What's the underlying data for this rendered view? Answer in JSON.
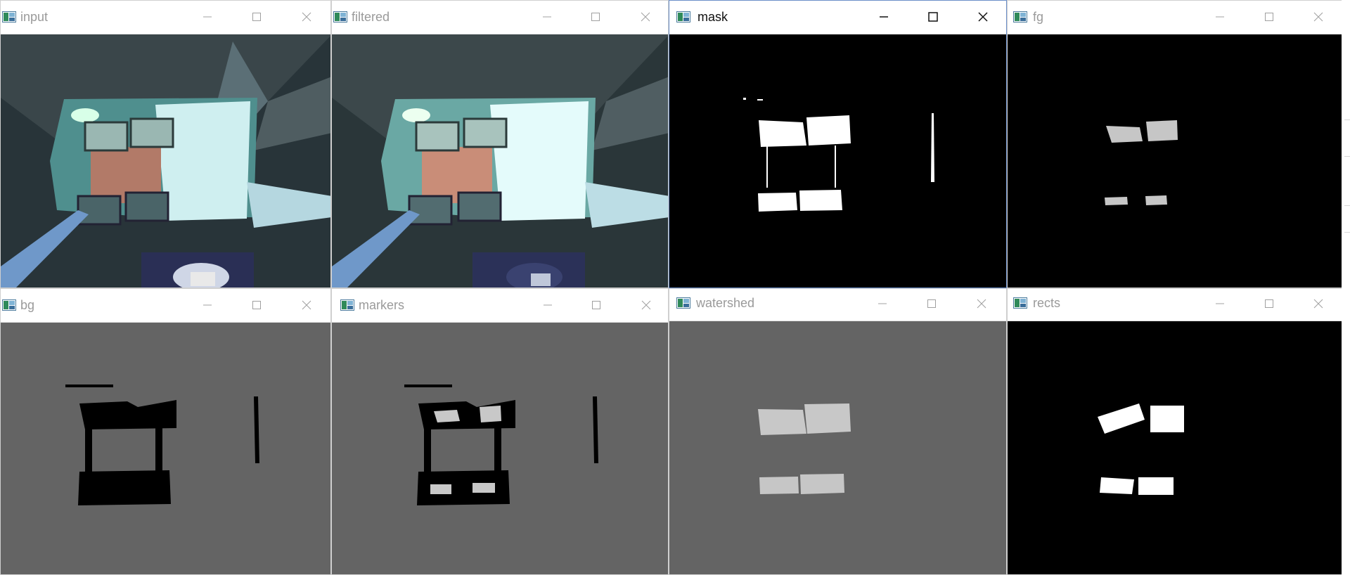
{
  "windows": {
    "input": {
      "title": "input",
      "active": false
    },
    "filtered": {
      "title": "filtered",
      "active": false
    },
    "mask": {
      "title": "mask",
      "active": true
    },
    "fg": {
      "title": "fg",
      "active": false
    },
    "bg": {
      "title": "bg",
      "active": false
    },
    "markers": {
      "title": "markers",
      "active": false
    },
    "watershed": {
      "title": "watershed",
      "active": false
    },
    "rects": {
      "title": "rects",
      "active": false
    }
  },
  "icons": {
    "app": "opencv-window-icon",
    "minimize": "minimize-icon",
    "maximize": "maximize-icon",
    "close": "close-icon"
  },
  "colors": {
    "title_inactive": "#9a9a9a",
    "title_active": "#111111",
    "active_border": "#6b8fc9",
    "mask_black": "#000000",
    "gray_background": "#646464",
    "marker_gray": "#c8c8c8",
    "white": "#ffffff"
  }
}
